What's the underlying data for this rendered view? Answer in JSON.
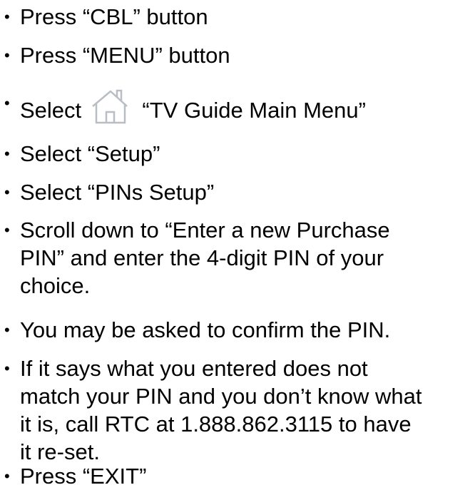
{
  "steps": [
    {
      "text": "Press “CBL” button"
    },
    {
      "text": "Press “MENU” button"
    },
    {
      "prefix": "Select",
      "icon": "home-icon",
      "suffix": "“TV Guide Main Menu”"
    },
    {
      "text": "Select “Setup”"
    },
    {
      "text": "Select “PINs Setup”"
    },
    {
      "lines": [
        "Scroll down to “Enter a new Purchase",
        "PIN” and enter the 4-digit PIN of your",
        "choice."
      ]
    },
    {
      "text": "You may be asked to confirm the PIN."
    },
    {
      "lines": [
        "If it says what you entered does not",
        "match your PIN and you don’t know what",
        "it is, call RTC at 1.888.862.3115 to have",
        "it re-set."
      ]
    },
    {
      "text": "Press “EXIT”"
    }
  ],
  "bullet_glyph": "•"
}
